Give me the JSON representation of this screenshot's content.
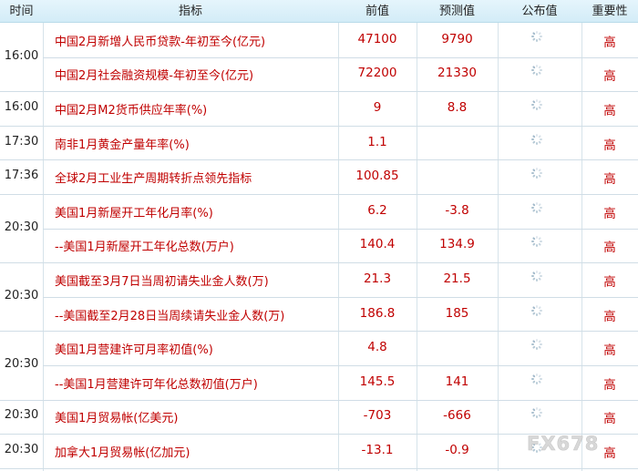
{
  "header": {
    "time": "时间",
    "indicator": "指标",
    "previous": "前值",
    "forecast": "预测值",
    "actual": "公布值",
    "importance": "重要性"
  },
  "groups": [
    {
      "time": "16:00",
      "rows": [
        {
          "indicator": "中国2月新增人民币贷款-年初至今(亿元)",
          "previous": "47100",
          "forecast": "9790",
          "importance": "高"
        },
        {
          "indicator": "中国2月社会融资规模-年初至今(亿元)",
          "previous": "72200",
          "forecast": "21330",
          "importance": "高"
        }
      ]
    },
    {
      "time": "16:00",
      "rows": [
        {
          "indicator": "中国2月M2货币供应年率(%)",
          "previous": "9",
          "forecast": "8.8",
          "importance": "高"
        }
      ]
    },
    {
      "time": "17:30",
      "rows": [
        {
          "indicator": "南非1月黄金产量年率(%)",
          "previous": "1.1",
          "forecast": "",
          "importance": "高"
        }
      ]
    },
    {
      "time": "17:36",
      "rows": [
        {
          "indicator": "全球2月工业生产周期转折点领先指标",
          "previous": "100.85",
          "forecast": "",
          "importance": "高"
        }
      ]
    },
    {
      "time": "20:30",
      "rows": [
        {
          "indicator": "美国1月新屋开工年化月率(%)",
          "previous": "6.2",
          "forecast": "-3.8",
          "importance": "高"
        },
        {
          "indicator": "--美国1月新屋开工年化总数(万户)",
          "previous": "140.4",
          "forecast": "134.9",
          "importance": "高"
        }
      ]
    },
    {
      "time": "20:30",
      "rows": [
        {
          "indicator": "美国截至3月7日当周初请失业金人数(万)",
          "previous": "21.3",
          "forecast": "21.5",
          "importance": "高"
        },
        {
          "indicator": "--美国截至2月28日当周续请失业金人数(万)",
          "previous": "186.8",
          "forecast": "185",
          "importance": "高"
        }
      ]
    },
    {
      "time": "20:30",
      "rows": [
        {
          "indicator": "美国1月营建许可月率初值(%)",
          "previous": "4.8",
          "forecast": "",
          "importance": "高"
        },
        {
          "indicator": "--美国1月营建许可年化总数初值(万户)",
          "previous": "145.5",
          "forecast": "141",
          "importance": "高"
        }
      ]
    },
    {
      "time": "20:30",
      "rows": [
        {
          "indicator": "美国1月贸易帐(亿美元)",
          "previous": "-703",
          "forecast": "-666",
          "importance": "高"
        }
      ]
    },
    {
      "time": "20:30",
      "rows": [
        {
          "indicator": "加拿大1月贸易帐(亿加元)",
          "previous": "-13.1",
          "forecast": "-0.9",
          "importance": "高"
        }
      ]
    }
  ],
  "watermark": "FX678",
  "icons": {
    "actual_pending": "loading-spinner-icon"
  },
  "colors": {
    "value_red": "#c00000",
    "header_bg": "#d8eef8"
  }
}
